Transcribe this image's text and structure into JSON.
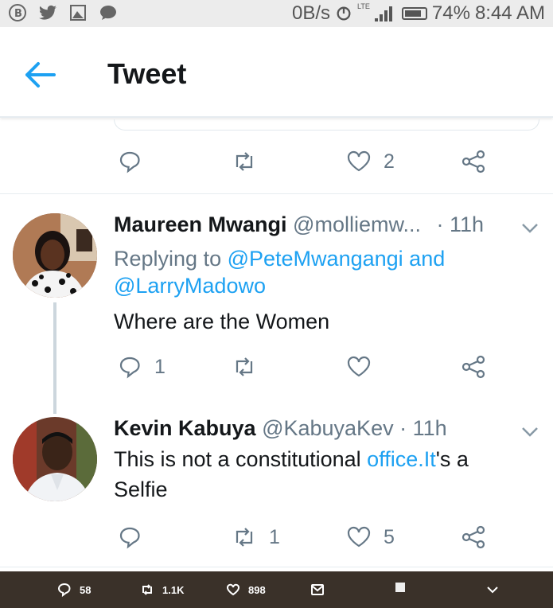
{
  "status_bar": {
    "left_icons": [
      "b-circle-icon",
      "bird-icon",
      "image-icon",
      "chat-bubble-icon"
    ],
    "network_speed": "0B/s",
    "network_type": "LTE",
    "battery": "74%",
    "time": "8:44 AM"
  },
  "header": {
    "title": "Tweet",
    "accent_color": "#1da1f2"
  },
  "top_actions": {
    "like_count": "2"
  },
  "tweets": [
    {
      "name": "Maureen Mwangi",
      "handle": "@molliemw...",
      "time": "· 11h",
      "replying_prefix": "Replying to",
      "mention_1": "@PeteMwangangi",
      "and_text": "and",
      "mention_2": "@LarryMadowo",
      "text": "Where are the Women",
      "reply_count": "1",
      "retweet_count": "",
      "like_count": ""
    },
    {
      "name": "Kevin Kabuya",
      "handle": "@KabuyaKev",
      "time": "· 11h",
      "text_before": "This is not a constitutional ",
      "text_link": "office.It",
      "text_after": "'s a",
      "text_line2": "Selfie",
      "reply_count": "",
      "retweet_count": "1",
      "like_count": "5"
    }
  ],
  "bottom_bar": {
    "replies": "58",
    "retweets": "1.1K",
    "likes": "898"
  }
}
